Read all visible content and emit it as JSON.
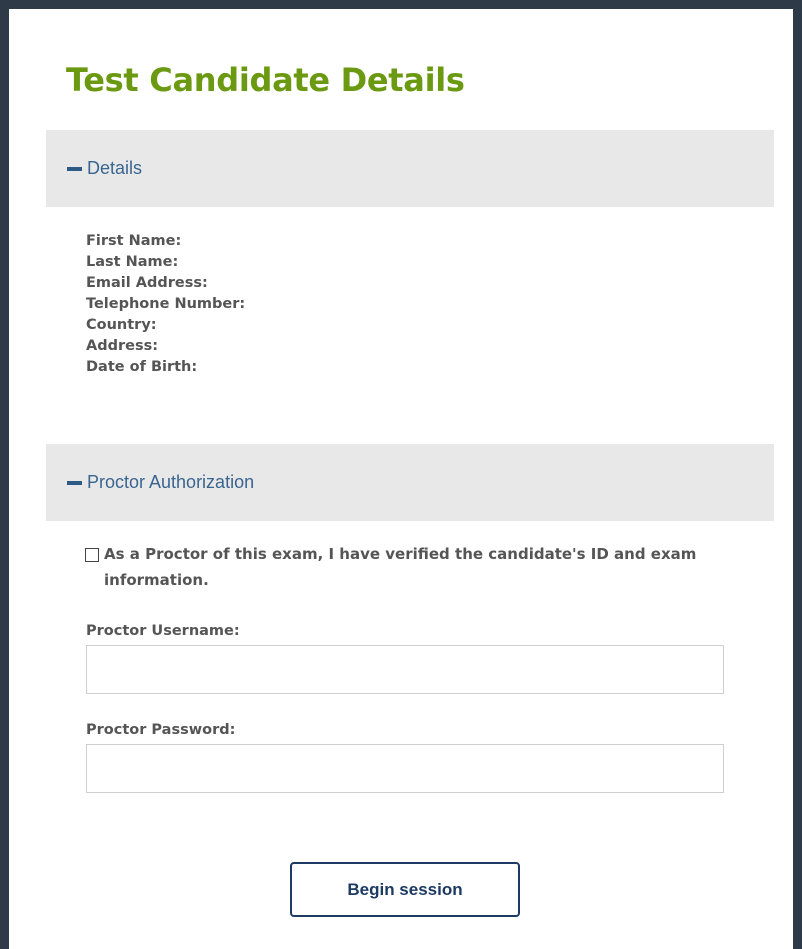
{
  "page": {
    "title": "Test Candidate Details"
  },
  "details_section": {
    "label": "Details",
    "fields": [
      "First Name:",
      "Last Name:",
      "Email Address:",
      "Telephone Number:",
      "Country:",
      "Address:",
      "Date of Birth:"
    ]
  },
  "proctor_section": {
    "label": "Proctor Authorization",
    "verify_text": "As a Proctor of this exam, I have verified the candidate's ID and exam information.",
    "verify_checked": false,
    "username_label": "Proctor Username:",
    "username_value": "",
    "password_label": "Proctor Password:",
    "password_value": ""
  },
  "actions": {
    "begin_label": "Begin session"
  },
  "colors": {
    "frame": "#2f3a48",
    "title": "#6b9a12",
    "section_bar": "#e8e8e8",
    "section_text": "#3a6590",
    "button_border": "#1d3a63"
  }
}
